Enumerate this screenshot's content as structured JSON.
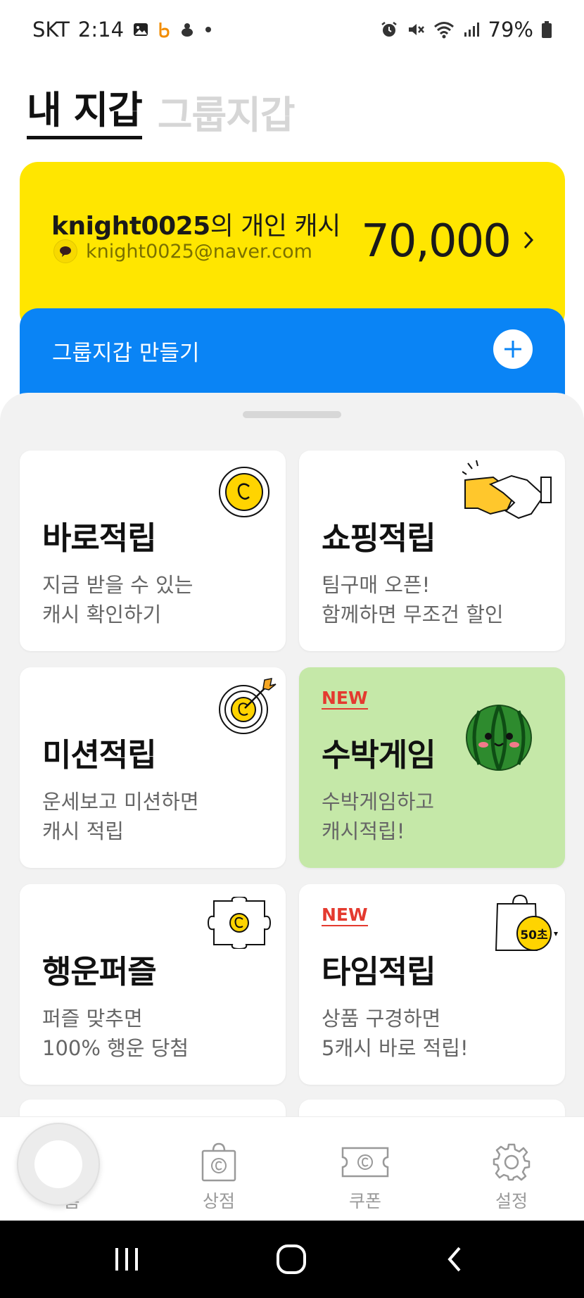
{
  "status_bar": {
    "carrier": "SKT",
    "time": "2:14",
    "battery": "79%",
    "left_icons": [
      "gallery-icon",
      "b-app-icon",
      "duck-icon",
      "dot-icon"
    ],
    "right_icons": [
      "alarm-icon",
      "mute-icon",
      "wifi-icon",
      "signal-icon",
      "battery-icon"
    ]
  },
  "wallet_tabs": [
    {
      "label": "내 지갑",
      "active": true
    },
    {
      "label": "그룹지갑",
      "active": false
    }
  ],
  "cash_card": {
    "username": "knight0025",
    "title_suffix": "의 개인 캐시",
    "email": "knight0025@naver.com",
    "amount": "70,000",
    "color": "#ffe600"
  },
  "group_bar": {
    "label": "그룹지갑 만들기",
    "color": "#0a84f5"
  },
  "cards": [
    {
      "title": "바로적립",
      "desc": [
        "지금 받을 수 있는",
        "캐시 확인하기"
      ],
      "badge": "",
      "icon": "coin-icon"
    },
    {
      "title": "쇼핑적립",
      "desc": [
        "팀구매 오픈!",
        "함께하면 무조건 할인"
      ],
      "badge": "",
      "icon": "handshake-icon"
    },
    {
      "title": "미션적립",
      "desc": [
        "운세보고 미션하면",
        "캐시 적립"
      ],
      "badge": "",
      "icon": "target-icon"
    },
    {
      "title": "수박게임",
      "desc": [
        "수박게임하고",
        "캐시적립!"
      ],
      "badge": "NEW",
      "icon": "watermelon-icon",
      "bg": "#c5e8a8"
    },
    {
      "title": "행운퍼즐",
      "desc": [
        "퍼즐 맞추면",
        "100% 행운 당첨"
      ],
      "badge": "",
      "icon": "puzzle-icon"
    },
    {
      "title": "타임적립",
      "desc": [
        "상품 구경하면",
        "5캐시 바로 적립!"
      ],
      "badge": "NEW",
      "icon": "shopping-bag-timer-icon",
      "icon_text": "50초"
    }
  ],
  "bottom_nav": [
    {
      "label": "홈",
      "icon": "home-icon",
      "active": true
    },
    {
      "label": "상점",
      "icon": "store-bag-icon",
      "active": false
    },
    {
      "label": "쿠폰",
      "icon": "coupon-icon",
      "active": false
    },
    {
      "label": "설정",
      "icon": "gear-icon",
      "active": false
    }
  ],
  "system_nav": [
    "recents-icon",
    "home-circle-icon",
    "back-icon"
  ]
}
